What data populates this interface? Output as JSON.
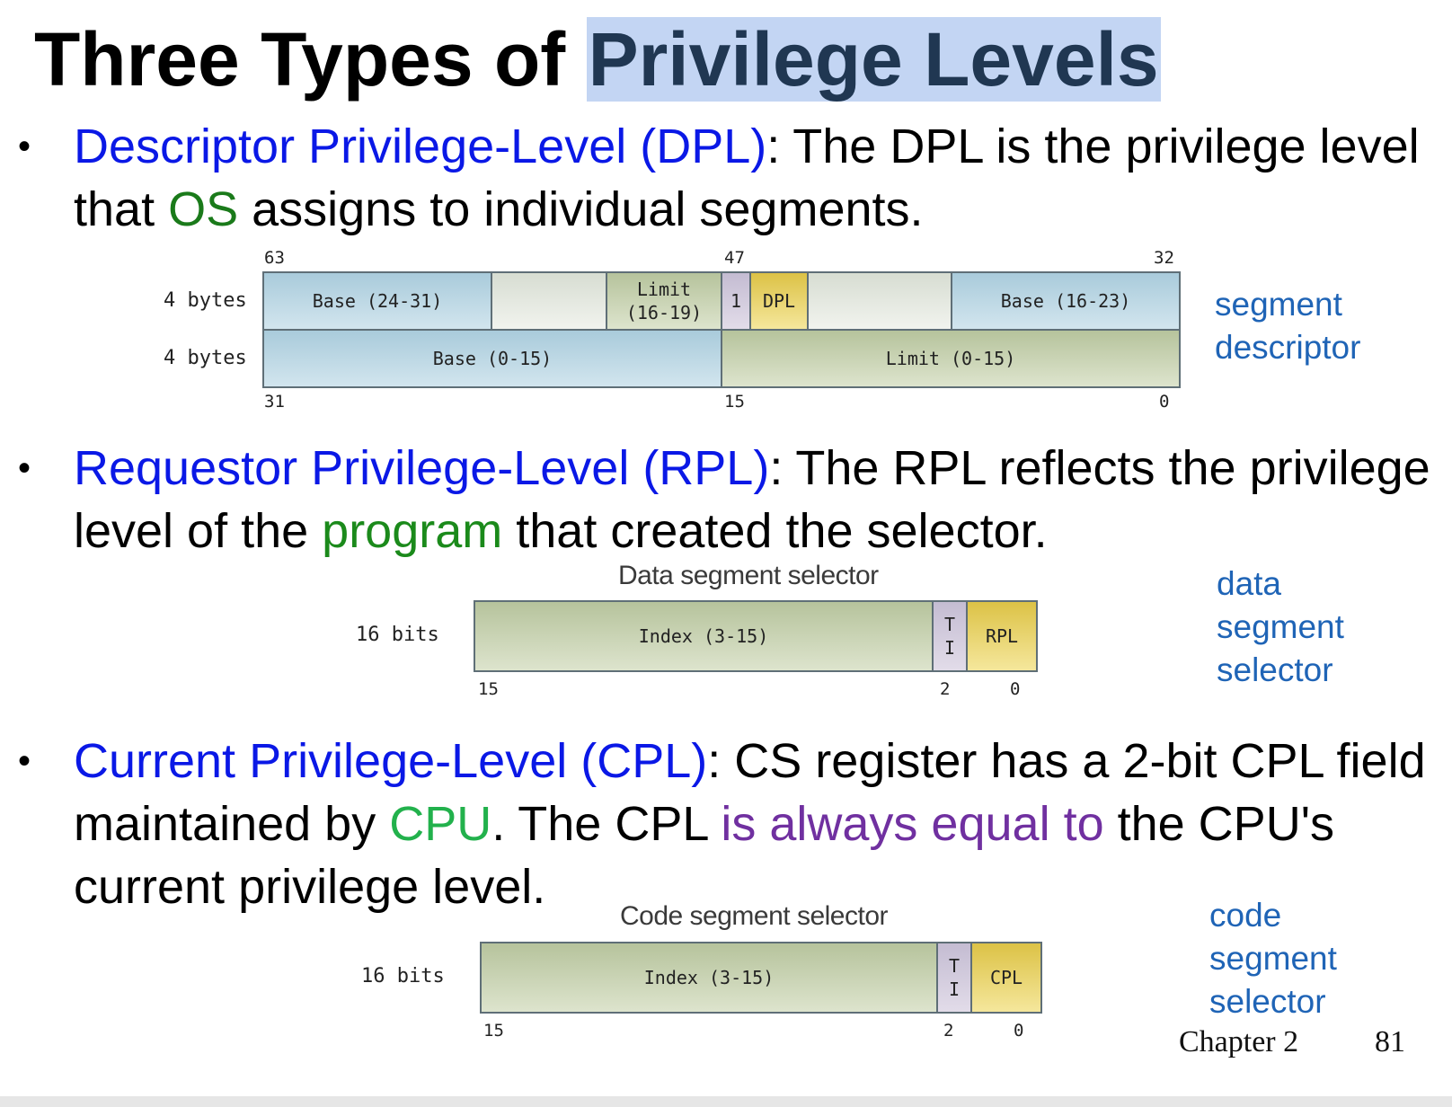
{
  "slide": {
    "title_plain": "Three Types of ",
    "title_highlight": "Privilege Levels",
    "bullet_dot": "•",
    "bullets": [
      {
        "parts": [
          {
            "text": "Descriptor Privilege-Level (DPL)",
            "color": "#0a18e6"
          },
          {
            "text": ": The DPL is the privilege level that ",
            "color": "#000000"
          },
          {
            "text": "OS",
            "color": "#1a7a1a"
          },
          {
            "text": " assigns to individual segments.",
            "color": "#000000"
          }
        ]
      },
      {
        "parts": [
          {
            "text": "Requestor Privilege-Level (RPL)",
            "color": "#0a18e6"
          },
          {
            "text": ": The RPL reflects the privilege level of the ",
            "color": "#000000"
          },
          {
            "text": "program",
            "color": "#1b8a1b"
          },
          {
            "text": " that created the selector.",
            "color": "#000000"
          }
        ]
      },
      {
        "parts": [
          {
            "text": "Current Privilege-Level (CPL)",
            "color": "#0a18e6"
          },
          {
            "text": ": CS register has a 2-bit CPL field maintained by ",
            "color": "#000000"
          },
          {
            "text": "CPU",
            "color": "#22b14c"
          },
          {
            "text": ". The CPL ",
            "color": "#000000"
          },
          {
            "text": "is always equal to",
            "color": "#7030a0"
          },
          {
            "text": " the CPU's current privilege level.",
            "color": "#000000"
          }
        ]
      }
    ]
  },
  "descriptor": {
    "bits_top": [
      "63",
      "47",
      "32"
    ],
    "bits_bottom": [
      "31",
      "15",
      "0"
    ],
    "row_labels": [
      "4 bytes",
      "4 bytes"
    ],
    "top_row": {
      "base_hi": "Base (24-31)",
      "limit_hi_line1": "Limit",
      "limit_hi_line2": "(16-19)",
      "one": "1",
      "dpl": "DPL",
      "base_mid": "Base (16-23)"
    },
    "bottom_row": {
      "base_lo": "Base (0-15)",
      "limit_lo": "Limit (0-15)"
    },
    "side_label_line1": "segment",
    "side_label_line2": "descriptor"
  },
  "data_selector": {
    "title": "Data segment selector",
    "row_label": "16 bits",
    "index": "Index (3-15)",
    "ti_t": "T",
    "ti_i": "I",
    "pl": "RPL",
    "bits": [
      "15",
      "2",
      "0"
    ],
    "side_label": [
      "data",
      "segment",
      "selector"
    ]
  },
  "code_selector": {
    "title": "Code segment selector",
    "row_label": "16 bits",
    "index": "Index (3-15)",
    "ti_t": "T",
    "ti_i": "I",
    "pl": "CPL",
    "bits": [
      "15",
      "2",
      "0"
    ],
    "side_label": [
      "code",
      "segment",
      "selector"
    ]
  },
  "footer": {
    "chapter": "Chapter 2",
    "page": "81"
  }
}
